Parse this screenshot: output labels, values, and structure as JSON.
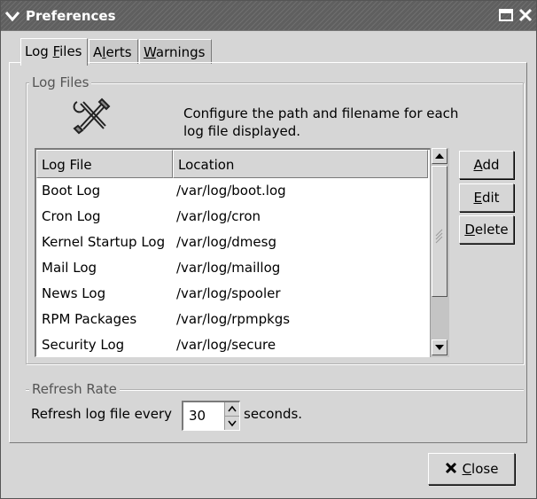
{
  "window": {
    "title": "Preferences"
  },
  "tabs": [
    {
      "pre": "Log ",
      "key": "F",
      "post": "iles"
    },
    {
      "pre": "A",
      "key": "l",
      "post": "erts"
    },
    {
      "pre": "",
      "key": "W",
      "post": "arnings"
    }
  ],
  "log_files_frame": {
    "label": "Log Files",
    "description_line1": "Configure the path and filename for each",
    "description_line2": "log file displayed.",
    "icon": "tools-icon",
    "columns": [
      "Log File",
      "Location"
    ],
    "rows": [
      {
        "name": "Boot Log",
        "location": "/var/log/boot.log"
      },
      {
        "name": "Cron Log",
        "location": "/var/log/cron"
      },
      {
        "name": "Kernel Startup Log",
        "location": "/var/log/dmesg"
      },
      {
        "name": "Mail Log",
        "location": "/var/log/maillog"
      },
      {
        "name": "News Log",
        "location": "/var/log/spooler"
      },
      {
        "name": "RPM Packages",
        "location": "/var/log/rpmpkgs"
      },
      {
        "name": "Security Log",
        "location": "/var/log/secure"
      }
    ],
    "buttons": {
      "add": {
        "key": "A",
        "rest": "dd"
      },
      "edit": {
        "key": "E",
        "rest": "dit"
      },
      "delete": {
        "key": "D",
        "rest": "elete"
      }
    }
  },
  "refresh_frame": {
    "label": "Refresh Rate",
    "prefix": "Refresh log file every",
    "value": "30",
    "suffix": "seconds."
  },
  "close_button": {
    "key": "C",
    "rest": "lose"
  }
}
